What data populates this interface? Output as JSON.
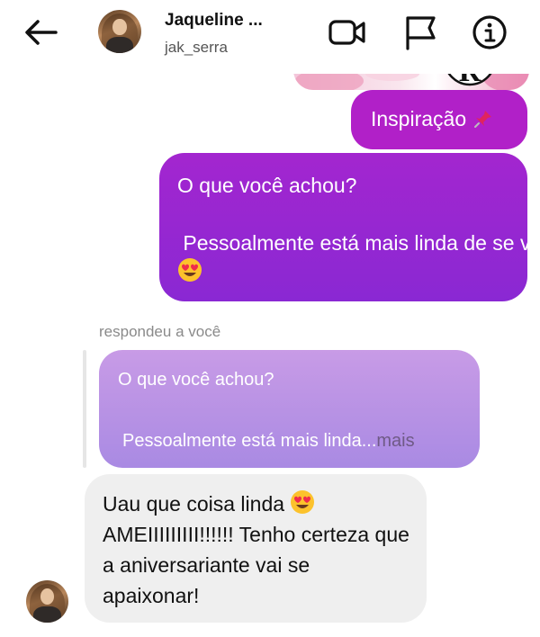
{
  "header": {
    "display_name": "Jaqueline ...",
    "username": "jak_serra",
    "icons": [
      "back-arrow-icon",
      "video-camera-icon",
      "flag-icon",
      "info-icon"
    ]
  },
  "shared_image": {
    "visible_text": "R"
  },
  "messages": {
    "sent_1": {
      "text": "Inspiração",
      "emoji": "pushpin"
    },
    "sent_2": {
      "line1": "O que você achou?",
      "line2": " Pessoalmente está mais linda de se ver!",
      "emoji": "heart-eyes"
    },
    "reply_label": "respondeu a você",
    "quoted": {
      "line1": "O que você achou?",
      "line2": "Pessoalmente está mais linda",
      "ellipsis": "...",
      "more": "mais"
    },
    "received": {
      "text_a": "Uau que coisa linda ",
      "text_b": "AMEIIIIIIIII!!!!!! Tenho certeza que a aniversariante vai se apaixonar!",
      "emoji": "heart-eyes"
    }
  },
  "colors": {
    "sent_bubble": "#b120c8",
    "sent_bubble_gradient": [
      "#a326cf",
      "#8a28d3"
    ],
    "quoted_bubble": "#c89be6",
    "received_bubble": "#efefef"
  }
}
